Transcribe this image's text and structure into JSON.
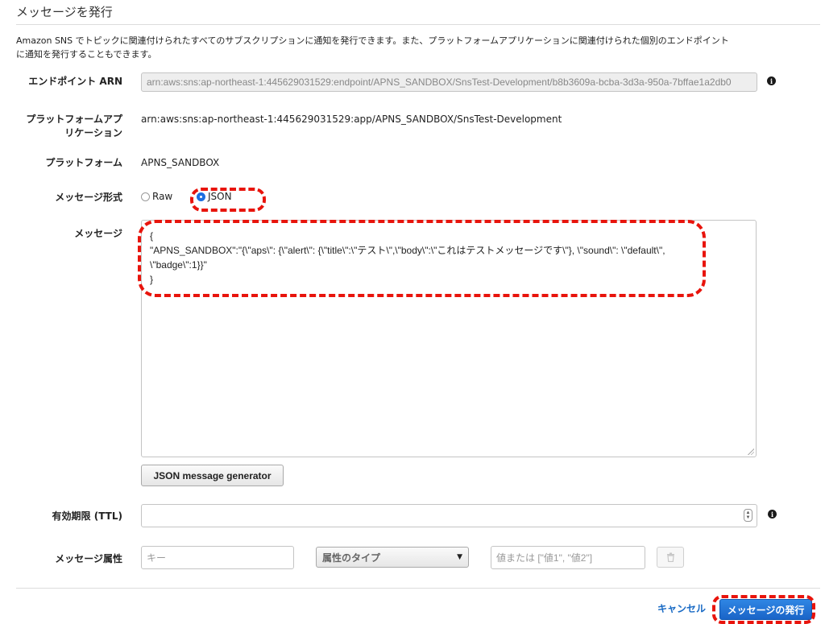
{
  "page": {
    "title": "メッセージを発行",
    "description_line1": "Amazon SNS でトピックに関連付けられたすべてのサブスクリプションに通知を発行できます。また、プラットフォームアプリケーションに関連付けられた個別のエンドポイント",
    "description_line2": "に通知を発行することもできます。"
  },
  "form": {
    "endpoint_arn": {
      "label": "エンドポイント ARN",
      "value": "arn:aws:sns:ap-northeast-1:445629031529:endpoint/APNS_SANDBOX/SnsTest-Development/b8b3609a-bcba-3d3a-950a-7bffae1a2db0"
    },
    "platform_app": {
      "label_line1": "プラットフォームアプ",
      "label_line2": "リケーション",
      "value": "arn:aws:sns:ap-northeast-1:445629031529:app/APNS_SANDBOX/SnsTest-Development"
    },
    "platform": {
      "label": "プラットフォーム",
      "value": "APNS_SANDBOX"
    },
    "message_format": {
      "label": "メッセージ形式",
      "options": [
        "Raw",
        "JSON"
      ],
      "selected": "JSON"
    },
    "message": {
      "label": "メッセージ",
      "lines": [
        "{",
        "\"APNS_SANDBOX\":\"{\\\"aps\\\": {\\\"alert\\\": {\\\"title\\\":\\\"テスト\\\",\\\"body\\\":\\\"これはテストメッセージです\\\"}, \\\"sound\\\": \\\"default\\\",",
        "\\\"badge\\\":1}}\"",
        "}"
      ]
    },
    "json_generator_button": "JSON message generator",
    "ttl": {
      "label": "有効期限 (TTL)",
      "value": ""
    },
    "attributes": {
      "label": "メッセージ属性",
      "key_placeholder": "キー",
      "type_select": "属性のタイプ",
      "value_placeholder": "値または [\"値1\", \"値2\"]"
    }
  },
  "footer": {
    "cancel_label": "キャンセル",
    "publish_label": "メッセージの発行"
  },
  "icons": {
    "info": "info-icon",
    "trash": "trash-icon",
    "caret": "caret-down-icon"
  },
  "colors": {
    "primary": "#1d6fe0",
    "link": "#1769c4",
    "annotation": "#e8140c"
  }
}
